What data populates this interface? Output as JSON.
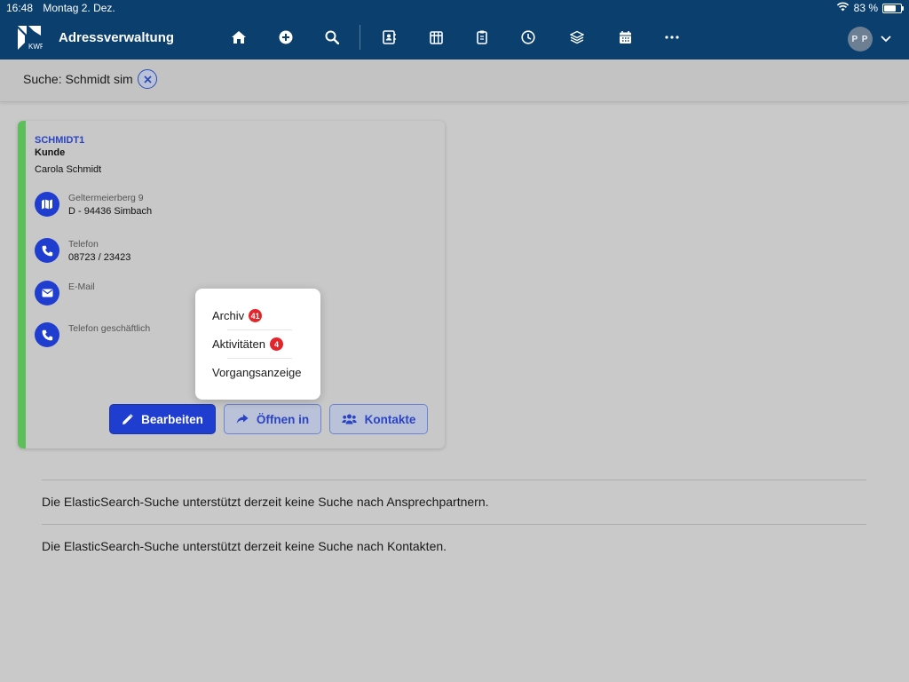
{
  "status_bar": {
    "time": "16:48",
    "date": "Montag 2. Dez.",
    "battery": "83 %",
    "battery_level": 0.83,
    "icons": [
      "wifi-icon",
      "battery-icon"
    ]
  },
  "navbar": {
    "logo_text": "KWP",
    "title": "Adressverwaltung",
    "icons": [
      "home-icon",
      "add-icon",
      "search-icon",
      "contacts-book-icon",
      "grid-icon",
      "clipboard-icon",
      "clock-icon",
      "layers-icon",
      "calendar-icon",
      "more-icon"
    ],
    "avatar_initials": "P P"
  },
  "search": {
    "label": "Suche: Schmidt sim"
  },
  "card": {
    "accent_color": "#5dbf5a",
    "code": "SCHMIDT1",
    "type": "Kunde",
    "name": "Carola Schmidt",
    "address": {
      "label": "Geltermeierberg 9",
      "value": "D - 94436 Simbach"
    },
    "phone": {
      "label": "Telefon",
      "value": "08723 / 23423"
    },
    "email": {
      "label": "E-Mail"
    },
    "phone_business": {
      "label": "Telefon geschäftlich"
    },
    "buttons": {
      "edit": "Bearbeiten",
      "open": "Öffnen in",
      "contacts": "Kontakte"
    }
  },
  "popover": {
    "items": [
      {
        "label": "Archiv",
        "badge": "41"
      },
      {
        "label": "Aktivitäten",
        "badge": "4"
      },
      {
        "label": "Vorgangsanzeige"
      }
    ]
  },
  "messages": [
    "Die ElasticSearch-Suche unterstützt derzeit keine Suche nach Ansprechpartnern.",
    "Die ElasticSearch-Suche unterstützt derzeit keine Suche nach Kontakten."
  ],
  "colors": {
    "primary": "#1f3ed0",
    "navbar": "#0a3f6e",
    "badge": "#e3242b"
  }
}
